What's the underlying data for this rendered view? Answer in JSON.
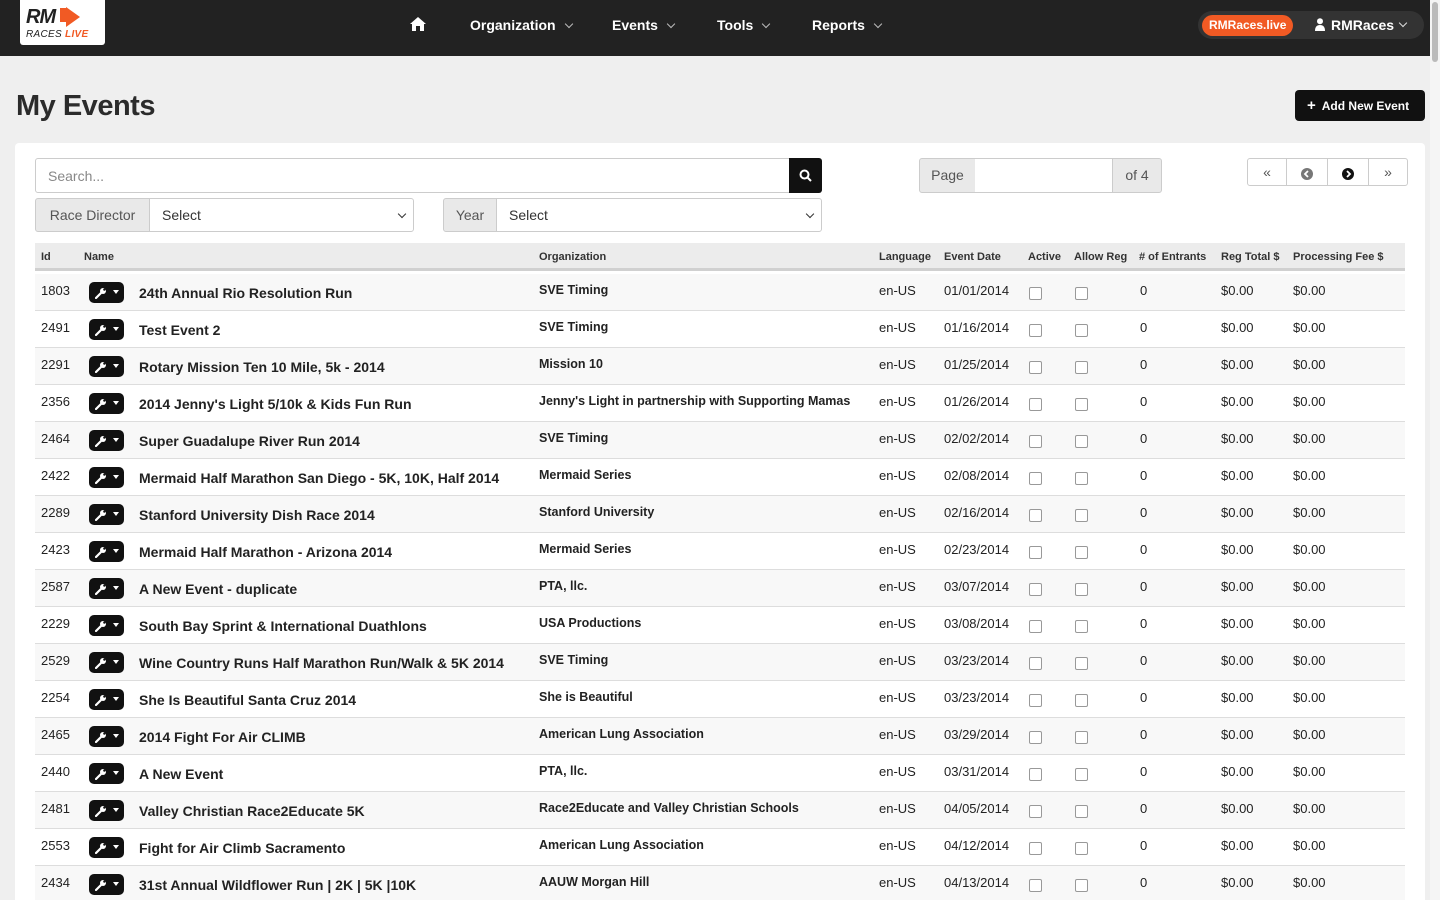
{
  "brand": {
    "logo_main": "RM",
    "logo_sub_a": "RACES ",
    "logo_sub_b": "LIVE",
    "badge": "RMRaces.live"
  },
  "nav": {
    "items": [
      {
        "label": "Organization"
      },
      {
        "label": "Events"
      },
      {
        "label": "Tools"
      },
      {
        "label": "Reports"
      }
    ],
    "user": "RMRaces"
  },
  "page": {
    "title": "My Events",
    "add_button": "Add New Event"
  },
  "filters": {
    "search_placeholder": "Search...",
    "race_director_label": "Race Director",
    "race_director_value": "Select",
    "year_label": "Year",
    "year_value": "Select"
  },
  "pagination": {
    "page_label": "Page",
    "page_value": "",
    "of_label": "of 4"
  },
  "table": {
    "headers": {
      "id": "Id",
      "name": "Name",
      "organization": "Organization",
      "language": "Language",
      "event_date": "Event Date",
      "active": "Active",
      "allow_reg": "Allow Reg",
      "entrants": "# of Entrants",
      "reg_total": "Reg Total $",
      "processing_fee": "Processing Fee $"
    },
    "rows": [
      {
        "id": "1803",
        "name": "24th Annual Rio Resolution Run",
        "org": "SVE Timing",
        "lang": "en-US",
        "date": "01/01/2014",
        "entrants": "0",
        "reg_total": "$0.00",
        "fee": "$0.00"
      },
      {
        "id": "2491",
        "name": "Test Event 2",
        "org": "SVE Timing",
        "lang": "en-US",
        "date": "01/16/2014",
        "entrants": "0",
        "reg_total": "$0.00",
        "fee": "$0.00"
      },
      {
        "id": "2291",
        "name": "Rotary Mission Ten 10 Mile, 5k - 2014",
        "org": "Mission 10",
        "lang": "en-US",
        "date": "01/25/2014",
        "entrants": "0",
        "reg_total": "$0.00",
        "fee": "$0.00"
      },
      {
        "id": "2356",
        "name": "2014 Jenny's Light 5/10k & Kids Fun Run",
        "org": "Jenny's Light in partnership with Supporting Mamas",
        "lang": "en-US",
        "date": "01/26/2014",
        "entrants": "0",
        "reg_total": "$0.00",
        "fee": "$0.00"
      },
      {
        "id": "2464",
        "name": "Super Guadalupe River Run 2014",
        "org": "SVE Timing",
        "lang": "en-US",
        "date": "02/02/2014",
        "entrants": "0",
        "reg_total": "$0.00",
        "fee": "$0.00"
      },
      {
        "id": "2422",
        "name": "Mermaid Half Marathon San Diego - 5K, 10K, Half 2014",
        "org": "Mermaid Series",
        "lang": "en-US",
        "date": "02/08/2014",
        "entrants": "0",
        "reg_total": "$0.00",
        "fee": "$0.00"
      },
      {
        "id": "2289",
        "name": "Stanford University Dish Race 2014",
        "org": "Stanford University",
        "lang": "en-US",
        "date": "02/16/2014",
        "entrants": "0",
        "reg_total": "$0.00",
        "fee": "$0.00"
      },
      {
        "id": "2423",
        "name": "Mermaid Half Marathon - Arizona 2014",
        "org": "Mermaid Series",
        "lang": "en-US",
        "date": "02/23/2014",
        "entrants": "0",
        "reg_total": "$0.00",
        "fee": "$0.00"
      },
      {
        "id": "2587",
        "name": "A New Event - duplicate",
        "org": "PTA, llc.",
        "lang": "en-US",
        "date": "03/07/2014",
        "entrants": "0",
        "reg_total": "$0.00",
        "fee": "$0.00"
      },
      {
        "id": "2229",
        "name": "South Bay Sprint & International Duathlons",
        "org": "USA Productions",
        "lang": "en-US",
        "date": "03/08/2014",
        "entrants": "0",
        "reg_total": "$0.00",
        "fee": "$0.00"
      },
      {
        "id": "2529",
        "name": "Wine Country Runs Half Marathon Run/Walk & 5K 2014",
        "org": "SVE Timing",
        "lang": "en-US",
        "date": "03/23/2014",
        "entrants": "0",
        "reg_total": "$0.00",
        "fee": "$0.00"
      },
      {
        "id": "2254",
        "name": "She Is Beautiful Santa Cruz 2014",
        "org": "She is Beautiful",
        "lang": "en-US",
        "date": "03/23/2014",
        "entrants": "0",
        "reg_total": "$0.00",
        "fee": "$0.00"
      },
      {
        "id": "2465",
        "name": "2014 Fight For Air CLIMB",
        "org": "American Lung Association",
        "lang": "en-US",
        "date": "03/29/2014",
        "entrants": "0",
        "reg_total": "$0.00",
        "fee": "$0.00"
      },
      {
        "id": "2440",
        "name": "A New Event",
        "org": "PTA, llc.",
        "lang": "en-US",
        "date": "03/31/2014",
        "entrants": "0",
        "reg_total": "$0.00",
        "fee": "$0.00"
      },
      {
        "id": "2481",
        "name": "Valley Christian Race2Educate 5K",
        "org": "Race2Educate and Valley Christian Schools",
        "lang": "en-US",
        "date": "04/05/2014",
        "entrants": "0",
        "reg_total": "$0.00",
        "fee": "$0.00"
      },
      {
        "id": "2553",
        "name": "Fight for Air Climb Sacramento",
        "org": "American Lung Association",
        "lang": "en-US",
        "date": "04/12/2014",
        "entrants": "0",
        "reg_total": "$0.00",
        "fee": "$0.00"
      },
      {
        "id": "2434",
        "name": "31st Annual Wildflower Run | 2K | 5K |10K",
        "org": "AAUW Morgan Hill",
        "lang": "en-US",
        "date": "04/13/2014",
        "entrants": "0",
        "reg_total": "$0.00",
        "fee": "$0.00"
      }
    ]
  }
}
